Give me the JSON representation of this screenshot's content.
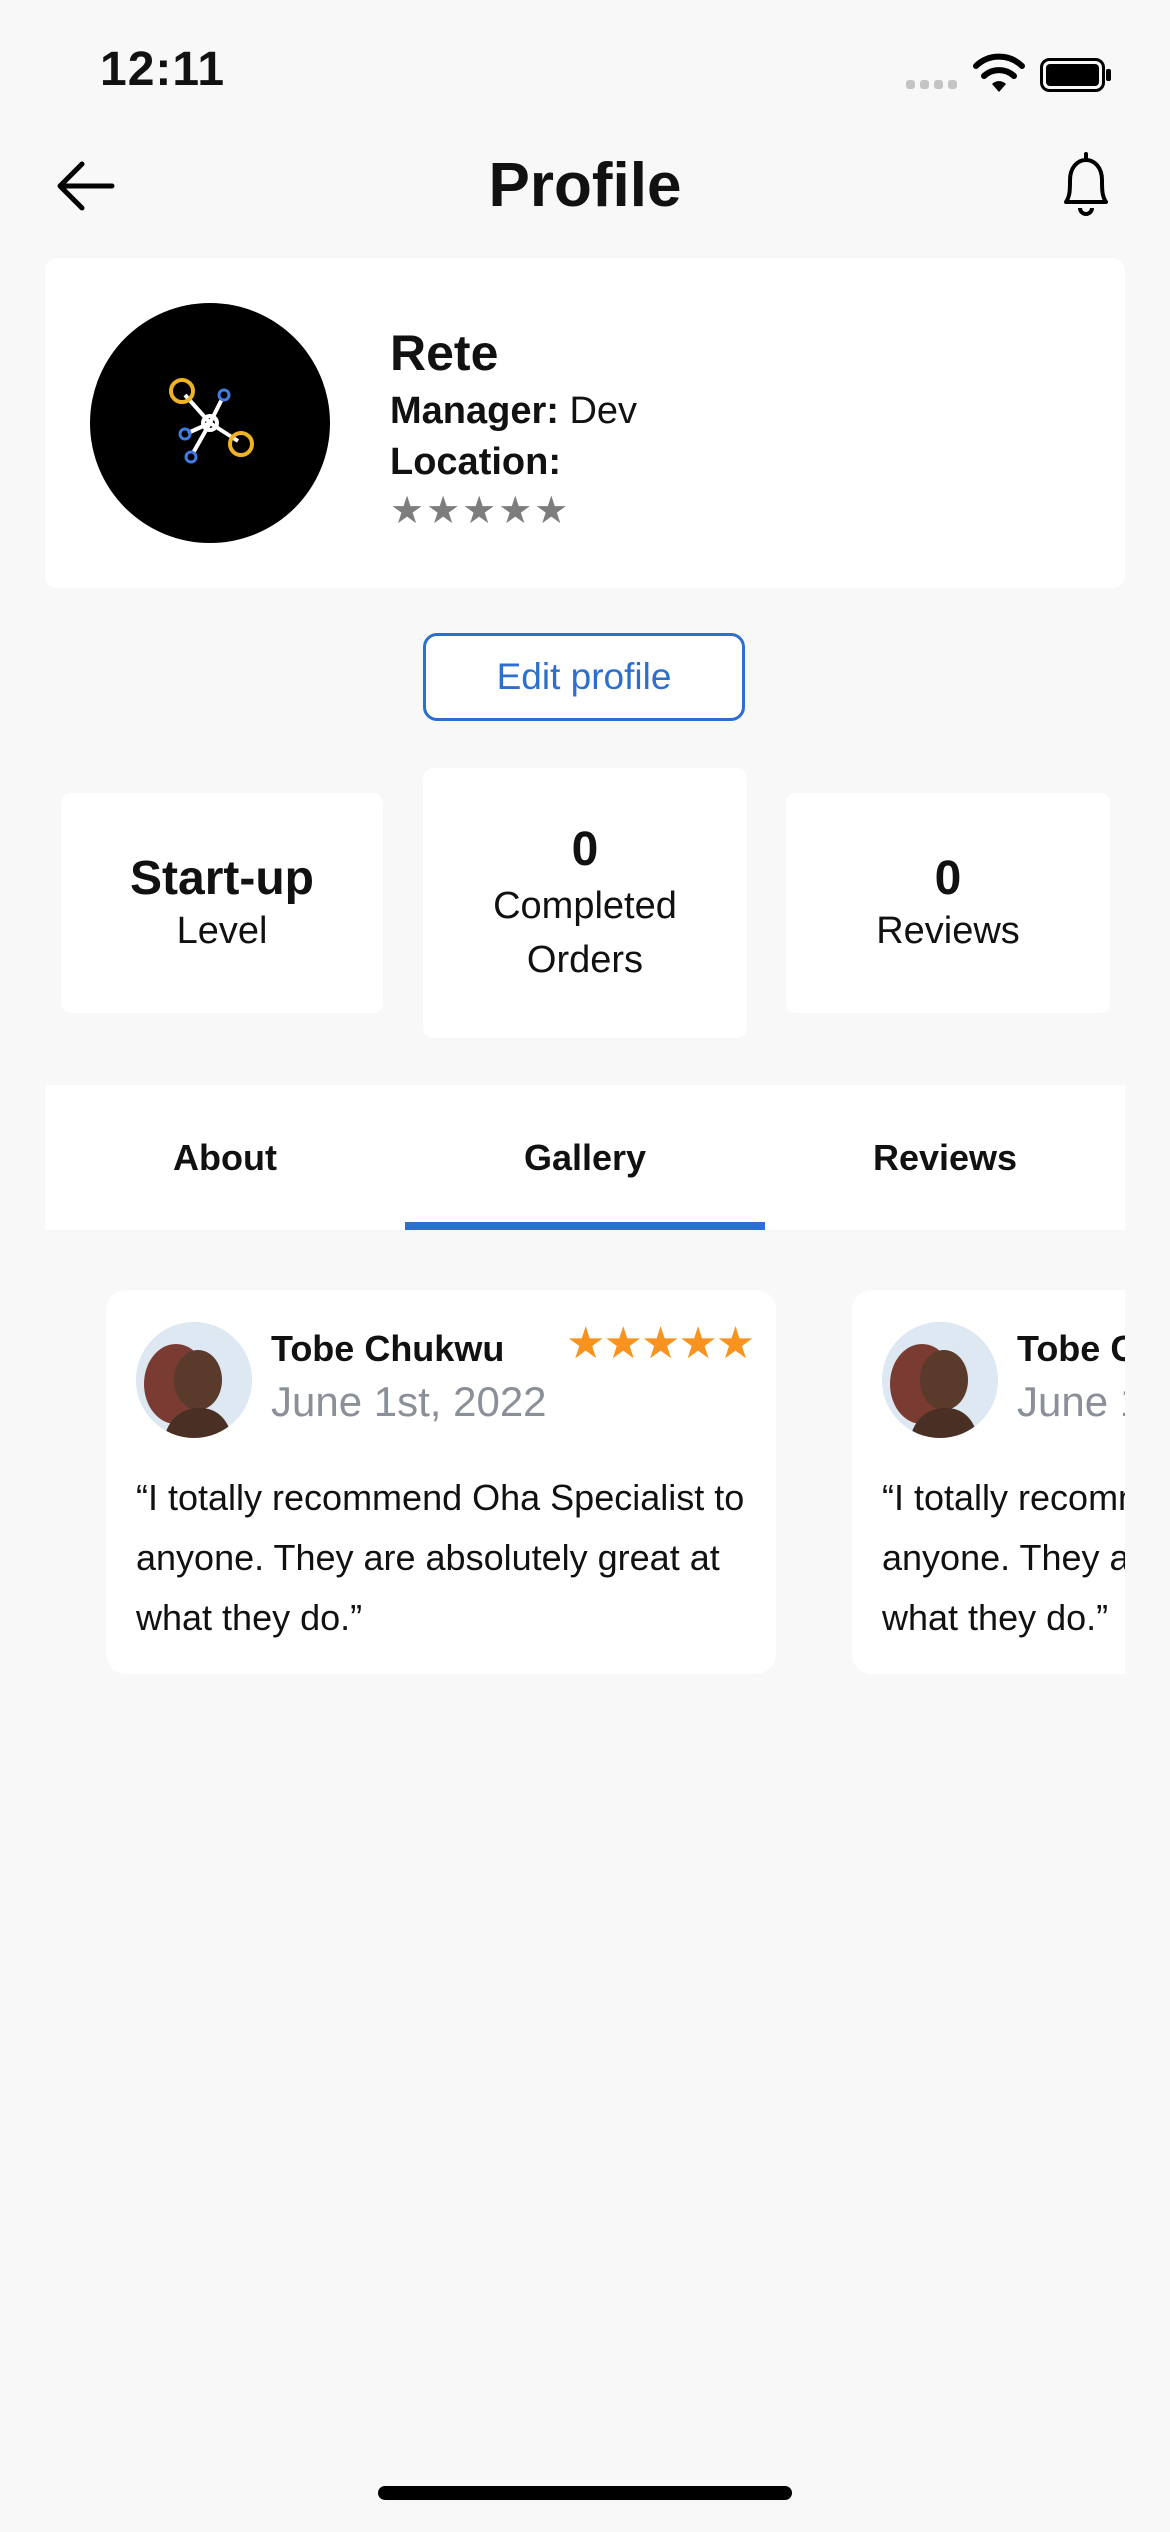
{
  "status_bar": {
    "time": "12:11"
  },
  "header": {
    "title": "Profile"
  },
  "profile": {
    "name": "Rete",
    "manager_label": "Manager:",
    "manager_value": "Dev",
    "location_label": "Location:",
    "rating_stars": "★★★★★",
    "rating_value": 0
  },
  "edit_button": {
    "label": "Edit profile"
  },
  "stats": {
    "level_value": "Start-up",
    "level_label": "Level",
    "orders_value": "0",
    "orders_label_line1": "Completed",
    "orders_label_line2": "Orders",
    "reviews_value": "0",
    "reviews_label": "Reviews"
  },
  "tabs": [
    {
      "label": "About"
    },
    {
      "label": "Gallery",
      "active": true
    },
    {
      "label": "Reviews"
    }
  ],
  "reviews": [
    {
      "name": "Tobe Chukwu",
      "date": "June 1st, 2022",
      "stars": "★★★★★",
      "text": "“I totally recommend Oha Specialist to anyone. They are absolutely great at what they do.”"
    },
    {
      "name": "Tobe Chukwu",
      "date": "June 1st, 2022",
      "stars": "★★★★★",
      "text": "“I totally recommend Oha Specialist to anyone. They are absolutely great at what they do.”"
    }
  ],
  "colors": {
    "accent": "#2c6fcf",
    "star_rating": "#f7931e",
    "star_empty": "#7d7d7d",
    "background": "#f8f8f8"
  },
  "icons": {
    "back": "back-arrow-icon",
    "notifications": "bell-icon",
    "signal": "cellular-signal-icon",
    "wifi": "wifi-icon",
    "battery": "battery-icon"
  }
}
